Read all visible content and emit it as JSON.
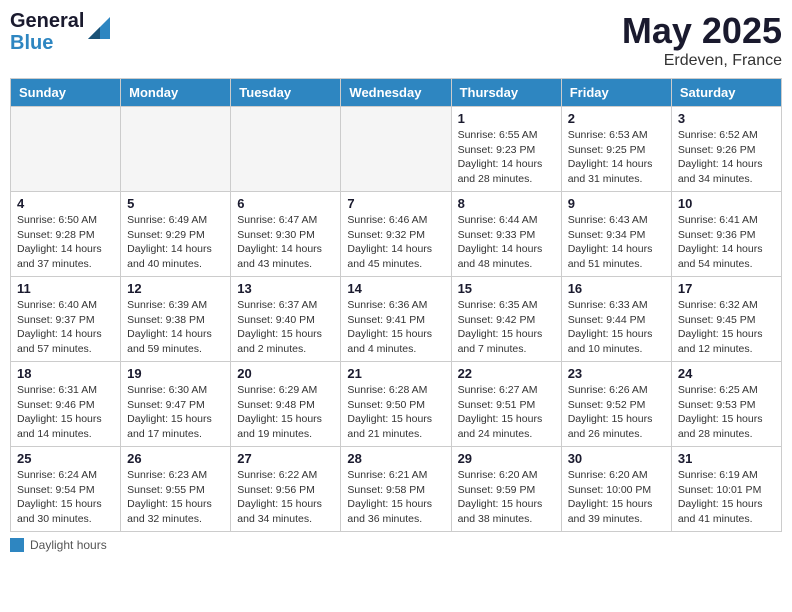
{
  "logo": {
    "line1": "General",
    "line2": "Blue"
  },
  "title": "May 2025",
  "location": "Erdeven, France",
  "days_header": [
    "Sunday",
    "Monday",
    "Tuesday",
    "Wednesday",
    "Thursday",
    "Friday",
    "Saturday"
  ],
  "footer_label": "Daylight hours",
  "weeks": [
    [
      {
        "day": "",
        "info": ""
      },
      {
        "day": "",
        "info": ""
      },
      {
        "day": "",
        "info": ""
      },
      {
        "day": "",
        "info": ""
      },
      {
        "day": "1",
        "info": "Sunrise: 6:55 AM\nSunset: 9:23 PM\nDaylight: 14 hours\nand 28 minutes."
      },
      {
        "day": "2",
        "info": "Sunrise: 6:53 AM\nSunset: 9:25 PM\nDaylight: 14 hours\nand 31 minutes."
      },
      {
        "day": "3",
        "info": "Sunrise: 6:52 AM\nSunset: 9:26 PM\nDaylight: 14 hours\nand 34 minutes."
      }
    ],
    [
      {
        "day": "4",
        "info": "Sunrise: 6:50 AM\nSunset: 9:28 PM\nDaylight: 14 hours\nand 37 minutes."
      },
      {
        "day": "5",
        "info": "Sunrise: 6:49 AM\nSunset: 9:29 PM\nDaylight: 14 hours\nand 40 minutes."
      },
      {
        "day": "6",
        "info": "Sunrise: 6:47 AM\nSunset: 9:30 PM\nDaylight: 14 hours\nand 43 minutes."
      },
      {
        "day": "7",
        "info": "Sunrise: 6:46 AM\nSunset: 9:32 PM\nDaylight: 14 hours\nand 45 minutes."
      },
      {
        "day": "8",
        "info": "Sunrise: 6:44 AM\nSunset: 9:33 PM\nDaylight: 14 hours\nand 48 minutes."
      },
      {
        "day": "9",
        "info": "Sunrise: 6:43 AM\nSunset: 9:34 PM\nDaylight: 14 hours\nand 51 minutes."
      },
      {
        "day": "10",
        "info": "Sunrise: 6:41 AM\nSunset: 9:36 PM\nDaylight: 14 hours\nand 54 minutes."
      }
    ],
    [
      {
        "day": "11",
        "info": "Sunrise: 6:40 AM\nSunset: 9:37 PM\nDaylight: 14 hours\nand 57 minutes."
      },
      {
        "day": "12",
        "info": "Sunrise: 6:39 AM\nSunset: 9:38 PM\nDaylight: 14 hours\nand 59 minutes."
      },
      {
        "day": "13",
        "info": "Sunrise: 6:37 AM\nSunset: 9:40 PM\nDaylight: 15 hours\nand 2 minutes."
      },
      {
        "day": "14",
        "info": "Sunrise: 6:36 AM\nSunset: 9:41 PM\nDaylight: 15 hours\nand 4 minutes."
      },
      {
        "day": "15",
        "info": "Sunrise: 6:35 AM\nSunset: 9:42 PM\nDaylight: 15 hours\nand 7 minutes."
      },
      {
        "day": "16",
        "info": "Sunrise: 6:33 AM\nSunset: 9:44 PM\nDaylight: 15 hours\nand 10 minutes."
      },
      {
        "day": "17",
        "info": "Sunrise: 6:32 AM\nSunset: 9:45 PM\nDaylight: 15 hours\nand 12 minutes."
      }
    ],
    [
      {
        "day": "18",
        "info": "Sunrise: 6:31 AM\nSunset: 9:46 PM\nDaylight: 15 hours\nand 14 minutes."
      },
      {
        "day": "19",
        "info": "Sunrise: 6:30 AM\nSunset: 9:47 PM\nDaylight: 15 hours\nand 17 minutes."
      },
      {
        "day": "20",
        "info": "Sunrise: 6:29 AM\nSunset: 9:48 PM\nDaylight: 15 hours\nand 19 minutes."
      },
      {
        "day": "21",
        "info": "Sunrise: 6:28 AM\nSunset: 9:50 PM\nDaylight: 15 hours\nand 21 minutes."
      },
      {
        "day": "22",
        "info": "Sunrise: 6:27 AM\nSunset: 9:51 PM\nDaylight: 15 hours\nand 24 minutes."
      },
      {
        "day": "23",
        "info": "Sunrise: 6:26 AM\nSunset: 9:52 PM\nDaylight: 15 hours\nand 26 minutes."
      },
      {
        "day": "24",
        "info": "Sunrise: 6:25 AM\nSunset: 9:53 PM\nDaylight: 15 hours\nand 28 minutes."
      }
    ],
    [
      {
        "day": "25",
        "info": "Sunrise: 6:24 AM\nSunset: 9:54 PM\nDaylight: 15 hours\nand 30 minutes."
      },
      {
        "day": "26",
        "info": "Sunrise: 6:23 AM\nSunset: 9:55 PM\nDaylight: 15 hours\nand 32 minutes."
      },
      {
        "day": "27",
        "info": "Sunrise: 6:22 AM\nSunset: 9:56 PM\nDaylight: 15 hours\nand 34 minutes."
      },
      {
        "day": "28",
        "info": "Sunrise: 6:21 AM\nSunset: 9:58 PM\nDaylight: 15 hours\nand 36 minutes."
      },
      {
        "day": "29",
        "info": "Sunrise: 6:20 AM\nSunset: 9:59 PM\nDaylight: 15 hours\nand 38 minutes."
      },
      {
        "day": "30",
        "info": "Sunrise: 6:20 AM\nSunset: 10:00 PM\nDaylight: 15 hours\nand 39 minutes."
      },
      {
        "day": "31",
        "info": "Sunrise: 6:19 AM\nSunset: 10:01 PM\nDaylight: 15 hours\nand 41 minutes."
      }
    ]
  ]
}
